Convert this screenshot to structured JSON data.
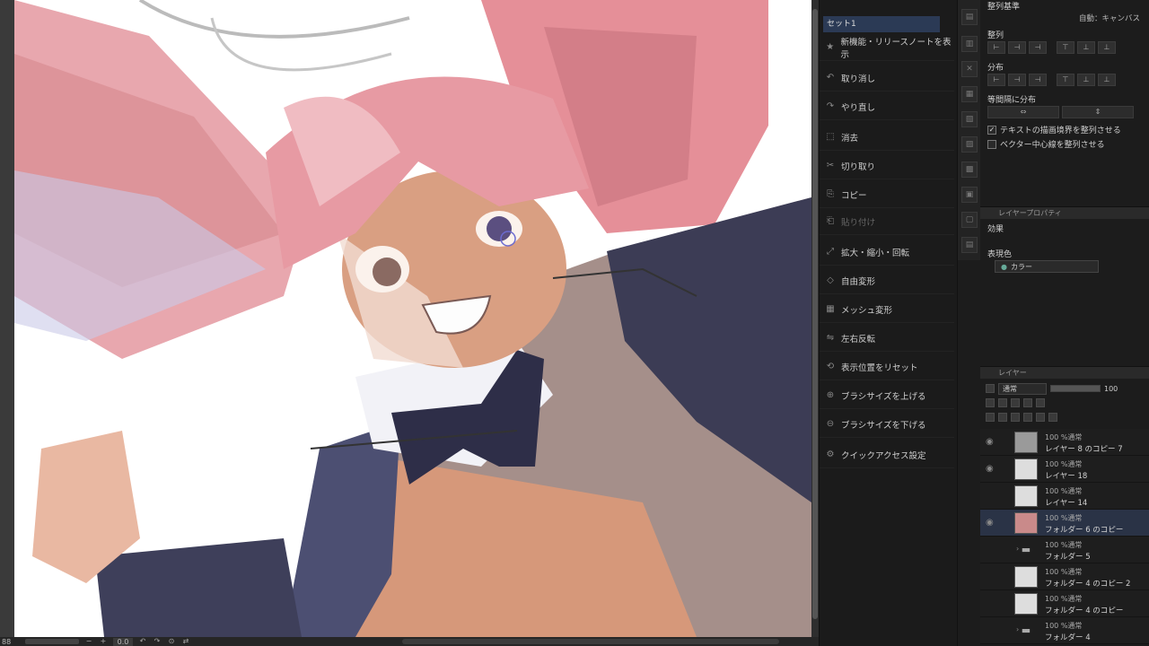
{
  "canvas": {
    "description_icons": []
  },
  "statusbar": {
    "zoom": "88",
    "minus": "−",
    "plus": "+",
    "rotation": "0.0",
    "icons": [
      "rotate-left-icon",
      "rotate-right-icon",
      "reset-icon",
      "flip-icon"
    ]
  },
  "quick_access": {
    "set_label": "セット1",
    "items": [
      {
        "label": "新機能・リリースノートを表示",
        "icon": "new-features-icon",
        "enabled": true
      },
      {
        "label": "取り消し",
        "icon": "undo-icon",
        "enabled": true
      },
      {
        "label": "やり直し",
        "icon": "redo-icon",
        "enabled": true
      },
      {
        "label": "消去",
        "icon": "erase-icon",
        "enabled": true
      },
      {
        "label": "切り取り",
        "icon": "cut-icon",
        "enabled": true
      },
      {
        "label": "コピー",
        "icon": "copy-icon",
        "enabled": true
      },
      {
        "label": "貼り付け",
        "icon": "paste-icon",
        "enabled": false
      },
      {
        "label": "拡大・縮小・回転",
        "icon": "scale-rotate-icon",
        "enabled": true
      },
      {
        "label": "自由変形",
        "icon": "free-transform-icon",
        "enabled": true
      },
      {
        "label": "メッシュ変形",
        "icon": "mesh-transform-icon",
        "enabled": true
      },
      {
        "label": "左右反転",
        "icon": "flip-horizontal-icon",
        "enabled": true
      },
      {
        "label": "表示位置をリセット",
        "icon": "reset-view-icon",
        "enabled": true
      },
      {
        "label": "ブラシサイズを上げる",
        "icon": "brush-size-up-icon",
        "enabled": true
      },
      {
        "label": "ブラシサイズを下げる",
        "icon": "brush-size-down-icon",
        "enabled": true
      },
      {
        "label": "クイックアクセス設定",
        "icon": "settings-icon",
        "enabled": true
      }
    ]
  },
  "align_panel": {
    "base_label": "整列基準",
    "base_value": "自動：キャンバス",
    "align_label": "整列",
    "distribute_label": "分布",
    "equal_spacing_label": "等間隔に分布",
    "check_text_bounds": "テキストの描画境界を整列させる",
    "check_vector_center": "ベクター中心線を整列させる"
  },
  "layer_property": {
    "tab_label": "レイヤープロパティ",
    "effect_label": "効果",
    "expression_color_label": "表現色",
    "expression_color_value": "カラー"
  },
  "layers_panel": {
    "tab_label": "レイヤー",
    "blend_mode": "通常",
    "opacity": "100",
    "layers": [
      {
        "mode": "100 %通常",
        "name": "レイヤー 8 のコピー 7",
        "thumb": "gray",
        "visible": true,
        "selected": false,
        "folder": false
      },
      {
        "mode": "100 %通常",
        "name": "レイヤー 18",
        "thumb": "sketch",
        "visible": true,
        "selected": false,
        "folder": false
      },
      {
        "mode": "100 %通常",
        "name": "レイヤー 14",
        "thumb": "sketch",
        "visible": false,
        "selected": false,
        "folder": false
      },
      {
        "mode": "100 %通常",
        "name": "フォルダー 6 のコピー",
        "thumb": "art",
        "visible": true,
        "selected": true,
        "folder": false
      },
      {
        "mode": "100 %通常",
        "name": "フォルダー 5",
        "thumb": "folder",
        "visible": false,
        "selected": false,
        "folder": true
      },
      {
        "mode": "100 %通常",
        "name": "フォルダー 4 のコピー 2",
        "thumb": "sketch",
        "visible": false,
        "selected": false,
        "folder": false
      },
      {
        "mode": "100 %通常",
        "name": "フォルダー 4 のコピー",
        "thumb": "sketch",
        "visible": false,
        "selected": false,
        "folder": false
      },
      {
        "mode": "100 %通常",
        "name": "フォルダー 4",
        "thumb": "folder",
        "visible": false,
        "selected": false,
        "folder": true
      }
    ]
  },
  "colors": {
    "hair": "#e8a0a8",
    "skin": "#d9a487",
    "jacket": "#3a3a52",
    "selected_row": "#2a3346"
  }
}
